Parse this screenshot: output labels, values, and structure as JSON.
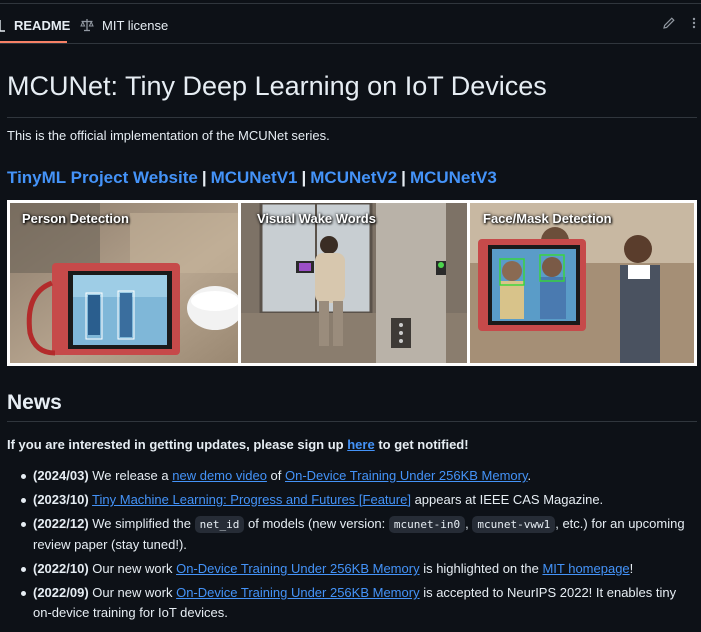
{
  "tabs": [
    {
      "label": "README",
      "icon": "book-icon",
      "active": true
    },
    {
      "label": "MIT license",
      "icon": "scale-icon",
      "active": false
    }
  ],
  "title": "MCUNet: Tiny Deep Learning on IoT Devices",
  "intro": "This is the official implementation of the MCUNet series.",
  "links": [
    {
      "label": "TinyML Project Website"
    },
    {
      "label": "MCUNetV1"
    },
    {
      "label": "MCUNetV2"
    },
    {
      "label": "MCUNetV3"
    }
  ],
  "link_separator": "|",
  "banner": {
    "panels": [
      {
        "label": "Person Detection"
      },
      {
        "label": "Visual Wake Words"
      },
      {
        "label": "Face/Mask Detection"
      }
    ]
  },
  "news": {
    "heading": "News",
    "signup_prefix": "If you are interested in getting updates, please sign up ",
    "signup_link": "here",
    "signup_suffix": " to get notified!",
    "items": [
      {
        "date": "(2024/03)",
        "t1": " We release a ",
        "l1": "new demo video",
        "t2": " of ",
        "l2": "On-Device Training Under 256KB Memory",
        "t3": "."
      },
      {
        "date": "(2023/10)",
        "t1": " ",
        "l1": "Tiny Machine Learning: Progress and Futures [Feature]",
        "t2": " appears at IEEE CAS Magazine."
      },
      {
        "date": "(2022/12)",
        "t1": " We simplified the ",
        "c1": "net_id",
        "t2": " of models (new version: ",
        "c2": "mcunet-in0",
        "t3": ", ",
        "c3": "mcunet-vww1",
        "t4": ", etc.) for an upcoming review paper (stay tuned!)."
      },
      {
        "date": "(2022/10)",
        "t1": " Our new work ",
        "l1": "On-Device Training Under 256KB Memory",
        "t2": " is highlighted on the ",
        "l2": "MIT homepage",
        "t3": "!"
      },
      {
        "date": "(2022/09)",
        "t1": " Our new work ",
        "l1": "On-Device Training Under 256KB Memory",
        "t2": " is accepted to NeurIPS 2022! It enables tiny on-device training for IoT devices."
      }
    ]
  },
  "colors": {
    "background": "#0d1117",
    "text": "#e6edf3",
    "link": "#4493f8",
    "border": "#30363d",
    "tab_underline": "#f78166"
  }
}
